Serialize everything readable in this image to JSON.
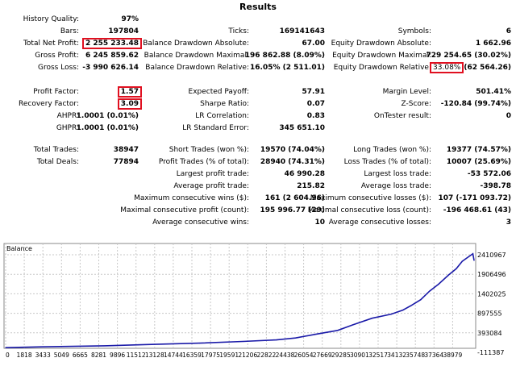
{
  "title": "Results",
  "section1": [
    {
      "l1": "History Quality:",
      "v1": "97%",
      "l2": "",
      "v2": "",
      "l3": "",
      "v3": ""
    },
    {
      "l1": "Bars:",
      "v1": "197804",
      "l2": "Ticks:",
      "v2": "169141643",
      "l3": "Symbols:",
      "v3": "6"
    },
    {
      "l1": "Total Net Profit:",
      "v1": "2 255 233.48",
      "l2": "Balance Drawdown Absolute:",
      "v2": "67.00",
      "l3": "Equity Drawdown Absolute:",
      "v3": "1 662.96"
    },
    {
      "l1": "Gross Profit:",
      "v1": "6 245 859.62",
      "l2": "Balance Drawdown Maximal:",
      "v2": "196 862.88 (8.09%)",
      "l3": "Equity Drawdown Maximal:",
      "v3": "729 254.65 (30.02%)"
    },
    {
      "l1": "Gross Loss:",
      "v1": "-3 990 626.14",
      "l2": "Balance Drawdown Relative:",
      "v2": "16.05% (2 511.01)",
      "l3": "Equity Drawdown Relative:",
      "v3a": "33.08%",
      "v3b": "(62 564.26)"
    }
  ],
  "section2": [
    {
      "l1": "Profit Factor:",
      "v1": "1.57",
      "l2": "Expected Payoff:",
      "v2": "57.91",
      "l3": "Margin Level:",
      "v3": "501.41%"
    },
    {
      "l1": "Recovery Factor:",
      "v1": "3.09",
      "l2": "Sharpe Ratio:",
      "v2": "0.07",
      "l3": "Z-Score:",
      "v3": "-120.84 (99.74%)"
    },
    {
      "l1": "AHPR:",
      "v1": "1.0001 (0.01%)",
      "l2": "LR Correlation:",
      "v2": "0.83",
      "l3": "OnTester result:",
      "v3": "0"
    },
    {
      "l1": "GHPR:",
      "v1": "1.0001 (0.01%)",
      "l2": "LR Standard Error:",
      "v2": "345 651.10",
      "l3": "",
      "v3": ""
    }
  ],
  "section3": [
    {
      "l1": "Total Trades:",
      "v1": "38947",
      "l2": "Short Trades (won %):",
      "v2": "19570 (74.04%)",
      "l3": "Long Trades (won %):",
      "v3": "19377 (74.57%)"
    },
    {
      "l1": "Total Deals:",
      "v1": "77894",
      "l2": "Profit Trades (% of total):",
      "v2": "28940 (74.31%)",
      "l3": "Loss Trades (% of total):",
      "v3": "10007 (25.69%)"
    },
    {
      "l1": "",
      "v1": "",
      "l2": "Largest profit trade:",
      "v2": "46 990.28",
      "l3": "Largest loss trade:",
      "v3": "-53 572.06"
    },
    {
      "l1": "",
      "v1": "",
      "l2": "Average profit trade:",
      "v2": "215.82",
      "l3": "Average loss trade:",
      "v3": "-398.78"
    },
    {
      "l1": "",
      "v1": "",
      "l2": "Maximum consecutive wins ($):",
      "v2": "161 (2 604.96)",
      "l3": "Maximum consecutive losses ($):",
      "v3": "107 (-171 093.72)"
    },
    {
      "l1": "",
      "v1": "",
      "l2": "Maximal consecutive profit (count):",
      "v2": "195 996.77 (29)",
      "l3": "Maximal consecutive loss (count):",
      "v3": "-196 468.61 (43)"
    },
    {
      "l1": "",
      "v1": "",
      "l2": "Average consecutive wins:",
      "v2": "10",
      "l3": "Average consecutive losses:",
      "v3": "3"
    }
  ],
  "chart_data": {
    "type": "line",
    "title": "Balance",
    "line_color": "#1a1aa8",
    "x": [
      0,
      3000,
      8281,
      12000,
      16359,
      20000,
      22822,
      24438,
      26054,
      28000,
      29285,
      30901,
      32517,
      33500,
      34132,
      35000,
      35748,
      36500,
      37364,
      38000,
      38500,
      39000,
      39400,
      39500
    ],
    "values": [
      10000,
      30000,
      56800,
      90000,
      126000,
      170000,
      210000,
      260000,
      351000,
      456000,
      600000,
      771000,
      876000,
      980000,
      1087000,
      1250000,
      1471000,
      1650000,
      1892000,
      2050000,
      2243000,
      2350000,
      2438000,
      2265233
    ],
    "ylim": [
      -111387,
      2410967
    ],
    "yticks": [
      "2410967",
      "1906496",
      "1402025",
      "897555",
      "393084",
      "-111387"
    ],
    "xticks": [
      "0",
      "1818",
      "3433",
      "5049",
      "6665",
      "8281",
      "9896",
      "11512",
      "13128",
      "14744",
      "16359",
      "17975",
      "19591",
      "21206",
      "22822",
      "24438",
      "26054",
      "27669",
      "29285",
      "30901",
      "32517",
      "34132",
      "35748",
      "37364",
      "38979"
    ]
  }
}
